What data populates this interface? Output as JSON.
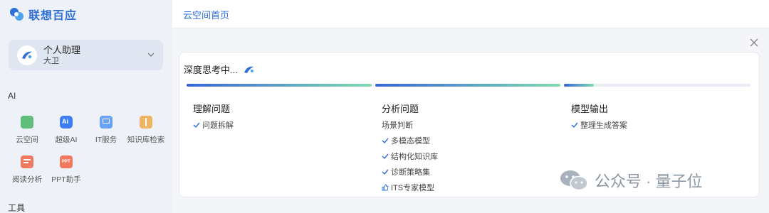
{
  "app": {
    "logo_text": "联想百应"
  },
  "assistant": {
    "title": "个人助理",
    "subtitle": "大卫"
  },
  "sections": {
    "ai_label": "AI",
    "tools_label": "工具"
  },
  "tools": [
    {
      "label": "云空间",
      "icon": "cloud-space-icon",
      "color": "#5fbf7a"
    },
    {
      "label": "超级AI",
      "icon": "super-ai-icon",
      "color": "#3d7ef0"
    },
    {
      "label": "IT服务",
      "icon": "it-service-icon",
      "color": "#6aa3f5"
    },
    {
      "label": "知识库检索",
      "icon": "knowledge-search-icon",
      "color": "#f0b562"
    },
    {
      "label": "阅读分析",
      "icon": "reading-analysis-icon",
      "color": "#f07a5f"
    },
    {
      "label": "PPT助手",
      "icon": "ppt-assistant-icon",
      "color": "#f07a5f"
    }
  ],
  "topbar": {
    "title": "云空间首页"
  },
  "panel": {
    "thinking_text": "深度思考中...",
    "stages": [
      {
        "title": "理解问题",
        "progress": 1.0,
        "items": [
          {
            "text": "问题拆解",
            "mark": "check"
          }
        ]
      },
      {
        "title": "分析问题",
        "progress": 1.0,
        "items": [
          {
            "text": "场景判断",
            "mark": "none"
          },
          {
            "text": "多模态模型",
            "mark": "check"
          },
          {
            "text": "结构化知识库",
            "mark": "check"
          },
          {
            "text": "诊断策略集",
            "mark": "check"
          },
          {
            "text": "ITS专家模型",
            "mark": "thumb"
          }
        ]
      },
      {
        "title": "模型输出",
        "progress": 0.16,
        "items": [
          {
            "text": "整理生成答案",
            "mark": "check"
          }
        ]
      }
    ]
  },
  "watermark": {
    "text": "公众号 · 量子位"
  },
  "colors": {
    "accent": "#2d6fd6",
    "bar_start": "#3b63d8",
    "bar_end": "#7fdcb0",
    "bar_track": "#e8ecf3"
  }
}
